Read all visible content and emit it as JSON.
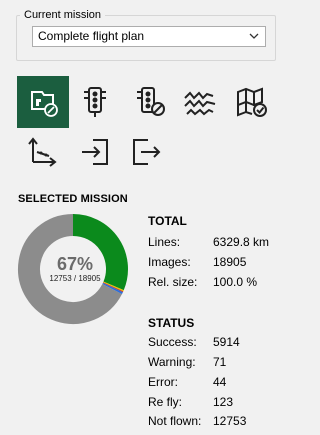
{
  "mission_group": {
    "legend": "Current mission",
    "selected": "Complete flight plan"
  },
  "toolbar": {
    "icons": [
      "edit-mission-icon",
      "traffic-light-icon",
      "traffic-light-status-icon",
      "terrain-lines-icon",
      "map-check-icon",
      "route-arrows-icon",
      "import-icon",
      "export-icon"
    ],
    "active_index": 0
  },
  "selected_mission": {
    "title": "SELECTED MISSION",
    "percent": "67%",
    "ratio": "12753 / 18905",
    "progress": {
      "success_fraction": 0.3128,
      "warning_fraction": 0.0038,
      "error_fraction": 0.0023,
      "refly_fraction": 0.0065,
      "notflown_fraction": 0.6746,
      "colors": {
        "success": "#0b8a1c",
        "warning": "#e8c400",
        "error": "#d12020",
        "refly": "#2f6fd6",
        "notflown": "#8c8c8c"
      }
    }
  },
  "total": {
    "heading": "TOTAL",
    "rows": [
      {
        "label": "Lines:",
        "value": "6329.8 km"
      },
      {
        "label": "Images:",
        "value": "18905"
      },
      {
        "label": "Rel. size:",
        "value": "100.0 %"
      }
    ]
  },
  "status": {
    "heading": "STATUS",
    "rows": [
      {
        "label": "Success:",
        "value": "5914"
      },
      {
        "label": "Warning:",
        "value": "71"
      },
      {
        "label": "Error:",
        "value": "44"
      },
      {
        "label": "Re fly:",
        "value": "123"
      },
      {
        "label": "Not flown:",
        "value": "12753"
      }
    ]
  }
}
